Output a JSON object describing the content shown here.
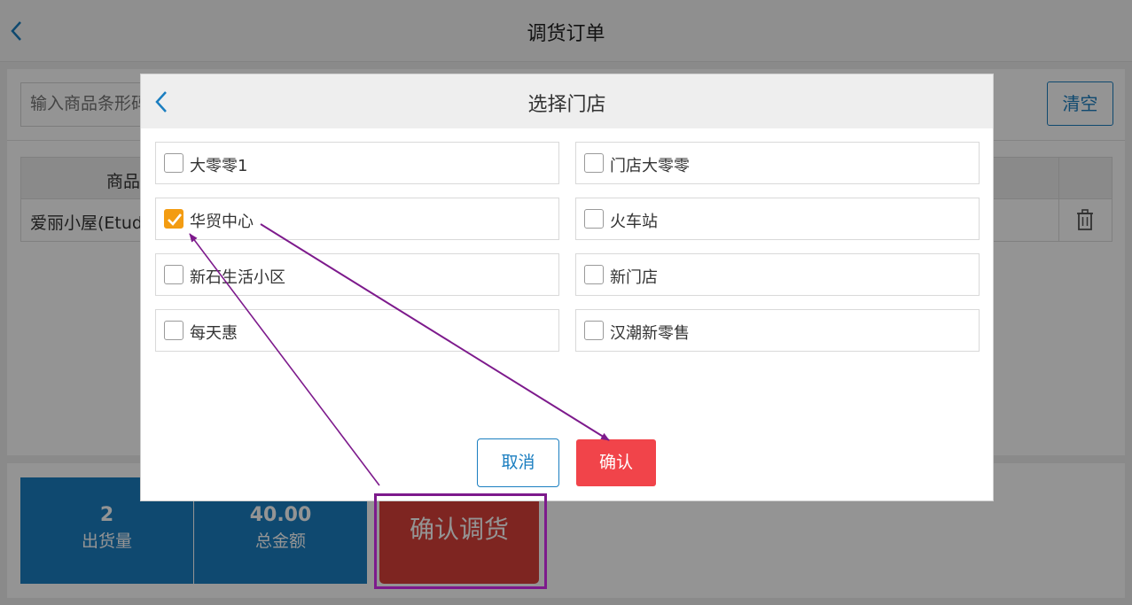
{
  "page": {
    "title": "调货订单"
  },
  "search": {
    "placeholder": "输入商品条形码"
  },
  "toolbar": {
    "clear_label": "清空"
  },
  "table": {
    "headers": [
      "商品"
    ],
    "rows": [
      {
        "name": "爱丽小屋(Etude)"
      }
    ]
  },
  "summary": {
    "quantity_value": "2",
    "quantity_label": "出货量",
    "amount_value": "40.00",
    "amount_label": "总金额",
    "confirm_label": "确认调货"
  },
  "modal": {
    "title": "选择门店",
    "stores": [
      {
        "name": "大零零1",
        "checked": false
      },
      {
        "name": "门店大零零",
        "checked": false
      },
      {
        "name": "华贸中心",
        "checked": true
      },
      {
        "name": "火车站",
        "checked": false
      },
      {
        "name": "新石生活小区",
        "checked": false
      },
      {
        "name": "新门店",
        "checked": false
      },
      {
        "name": "每天惠",
        "checked": false
      },
      {
        "name": "汉潮新零售",
        "checked": false
      }
    ],
    "cancel_label": "取消",
    "confirm_label": "确认"
  },
  "colors": {
    "accent_blue": "#1a7ec0",
    "check_orange": "#f39c12",
    "confirm_red": "#f1444a",
    "annotation_purple": "#7d1a8c"
  }
}
